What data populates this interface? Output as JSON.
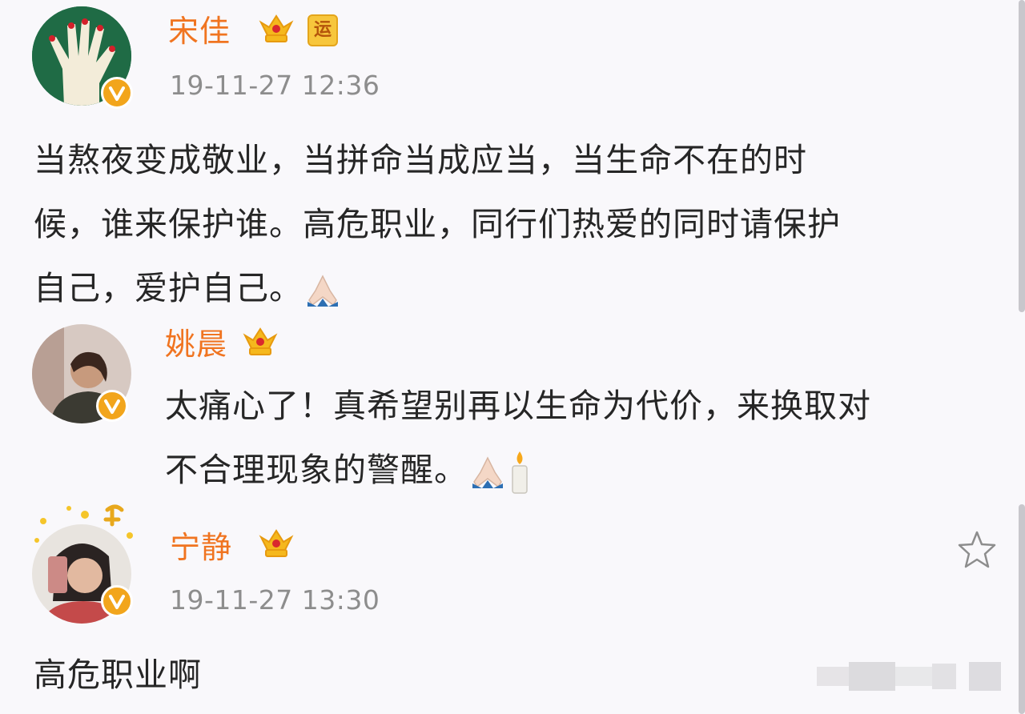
{
  "posts": [
    {
      "author": "宋佳",
      "time": "19-11-27 12:36",
      "badge_label": "运",
      "text_lines": [
        "当熬夜变成敬业，当拼命当成应当，当生命不在的时",
        "候，谁来保护谁。高危职业，同行们热爱的同时请保护",
        "自己，爱护自己。"
      ]
    },
    {
      "author": "姚晨",
      "text_lines": [
        "太痛心了！真希望别再以生命为代价，来换取对",
        "不合理现象的警醒。"
      ]
    },
    {
      "author": "宁静",
      "time": "19-11-27 13:30",
      "text_lines": [
        "高危职业啊"
      ]
    }
  ],
  "colors": {
    "name": "#f07420",
    "time": "#8d8d8d",
    "text": "#262626",
    "crown": "#f5b81d",
    "verified_badge": "#f2a51c",
    "background": "#f9f8fb"
  },
  "icons": {
    "crown": "crown-icon",
    "verified": "verified-v-icon",
    "pray": "pray-emoji-icon",
    "candle": "candle-emoji-icon",
    "favorite": "star-icon"
  }
}
